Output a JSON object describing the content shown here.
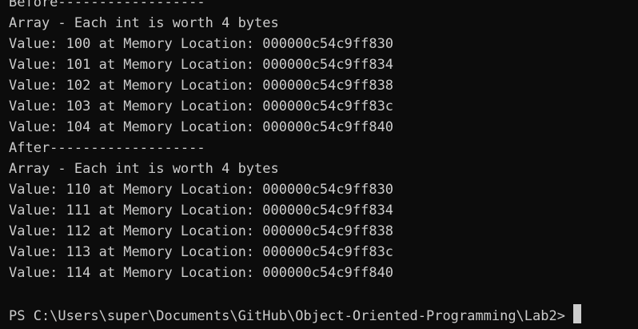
{
  "terminal": {
    "colors": {
      "background": "#0c0c0c",
      "text": "#cccccc",
      "cursor": "#cccccc"
    },
    "lines": [
      "Before------------------",
      "Array - Each int is worth 4 bytes",
      "Value: 100 at Memory Location: 000000c54c9ff830",
      "Value: 101 at Memory Location: 000000c54c9ff834",
      "Value: 102 at Memory Location: 000000c54c9ff838",
      "Value: 103 at Memory Location: 000000c54c9ff83c",
      "Value: 104 at Memory Location: 000000c54c9ff840",
      "After-------------------",
      "Array - Each int is worth 4 bytes",
      "Value: 110 at Memory Location: 000000c54c9ff830",
      "Value: 111 at Memory Location: 000000c54c9ff834",
      "Value: 112 at Memory Location: 000000c54c9ff838",
      "Value: 113 at Memory Location: 000000c54c9ff83c",
      "Value: 114 at Memory Location: 000000c54c9ff840"
    ],
    "prompt": "PS C:\\Users\\super\\Documents\\GitHub\\Object-Oriented-Programming\\Lab2>"
  }
}
